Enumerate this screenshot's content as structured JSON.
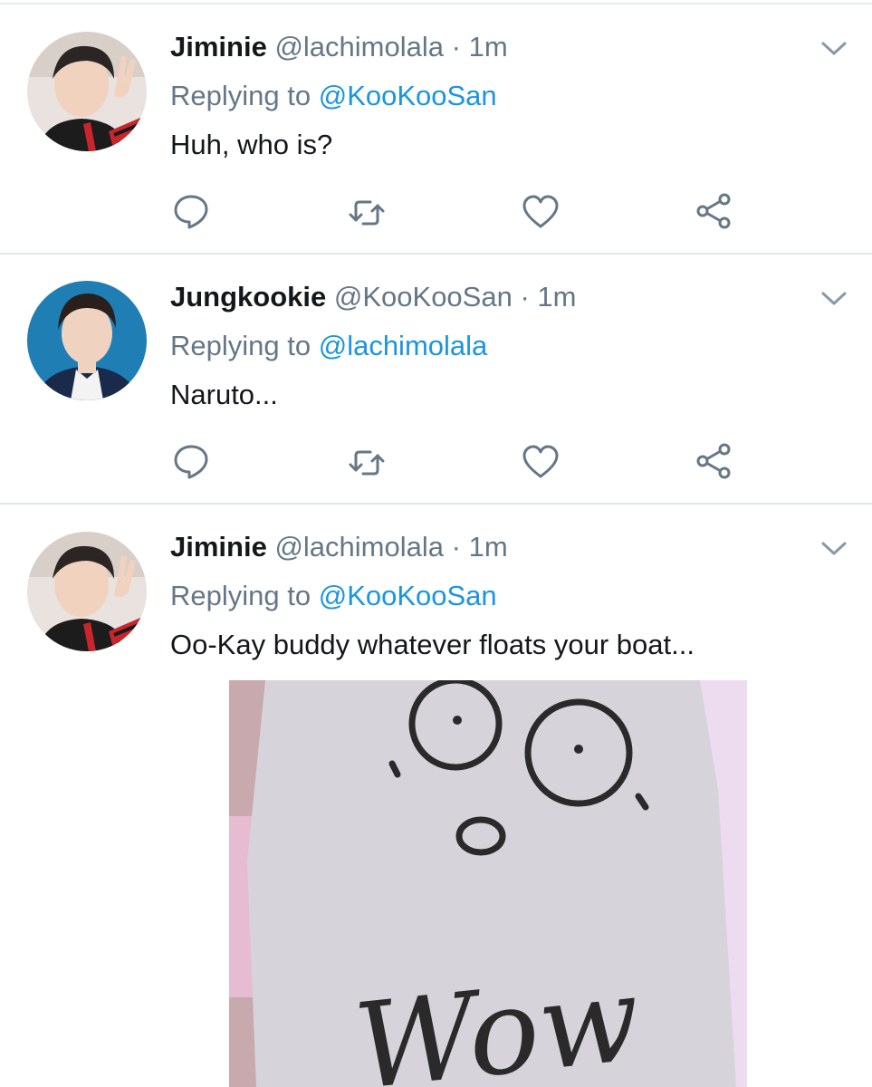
{
  "tweets": [
    {
      "display_name": "Jiminie",
      "handle": "@lachimolala",
      "separator": "·",
      "time": "1m",
      "replying_prefix": "Replying to",
      "replying_to": "@KooKooSan",
      "text": "Huh, who is?"
    },
    {
      "display_name": "Jungkookie",
      "handle": "@KooKooSan",
      "separator": "·",
      "time": "1m",
      "replying_prefix": "Replying to",
      "replying_to": "@lachimolala",
      "text": "Naruto..."
    },
    {
      "display_name": "Jiminie",
      "handle": "@lachimolala",
      "separator": "·",
      "time": "1m",
      "replying_prefix": "Replying to",
      "replying_to": "@KooKooSan",
      "text": "Oo-Kay buddy whatever floats your boat...",
      "media": {
        "drawing_text": "Wow"
      }
    }
  ],
  "icons": {
    "reply": "reply-icon",
    "retweet": "retweet-icon",
    "like": "heart-icon",
    "share": "share-icon",
    "menu": "chevron-down-icon"
  },
  "colors": {
    "text_primary": "#14171a",
    "text_secondary": "#657786",
    "mention_blue": "#1b95e0",
    "icon_gray": "#657786",
    "divider": "#e1e8ed"
  }
}
